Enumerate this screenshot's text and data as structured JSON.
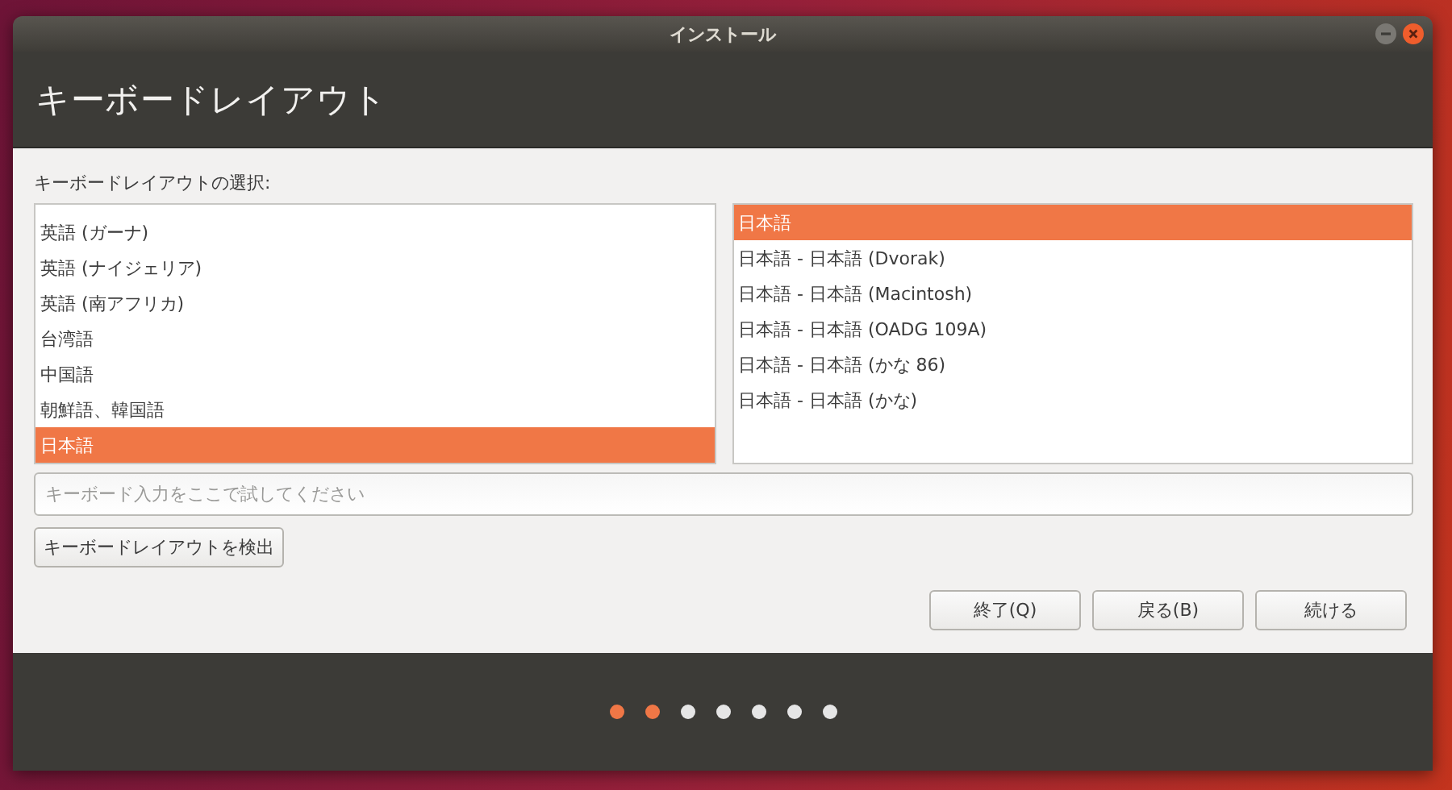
{
  "window": {
    "title": "インストール"
  },
  "header": {
    "title": "キーボードレイアウト"
  },
  "layout_label": "キーボードレイアウトの選択:",
  "languages": [
    {
      "label": "英語 (ガーナ)",
      "selected": false
    },
    {
      "label": "英語 (ナイジェリア)",
      "selected": false
    },
    {
      "label": "英語 (南アフリカ)",
      "selected": false
    },
    {
      "label": "台湾語",
      "selected": false
    },
    {
      "label": "中国語",
      "selected": false
    },
    {
      "label": "朝鮮語、韓国語",
      "selected": false
    },
    {
      "label": "日本語",
      "selected": true
    }
  ],
  "variants": [
    {
      "label": "日本語",
      "selected": true
    },
    {
      "label": "日本語 - 日本語 (Dvorak)",
      "selected": false
    },
    {
      "label": "日本語 - 日本語 (Macintosh)",
      "selected": false
    },
    {
      "label": "日本語 - 日本語 (OADG 109A)",
      "selected": false
    },
    {
      "label": "日本語 - 日本語 (かな 86)",
      "selected": false
    },
    {
      "label": "日本語 - 日本語 (かな)",
      "selected": false
    }
  ],
  "test_field": {
    "placeholder": "キーボード入力をここで試してください"
  },
  "detect_button": "キーボードレイアウトを検出",
  "buttons": [
    "終了(Q)",
    "戻る(B)",
    "続ける"
  ],
  "progress": [
    {
      "done": true
    },
    {
      "done": true
    },
    {
      "done": false
    },
    {
      "done": false
    },
    {
      "done": false
    },
    {
      "done": false
    },
    {
      "done": false
    }
  ]
}
